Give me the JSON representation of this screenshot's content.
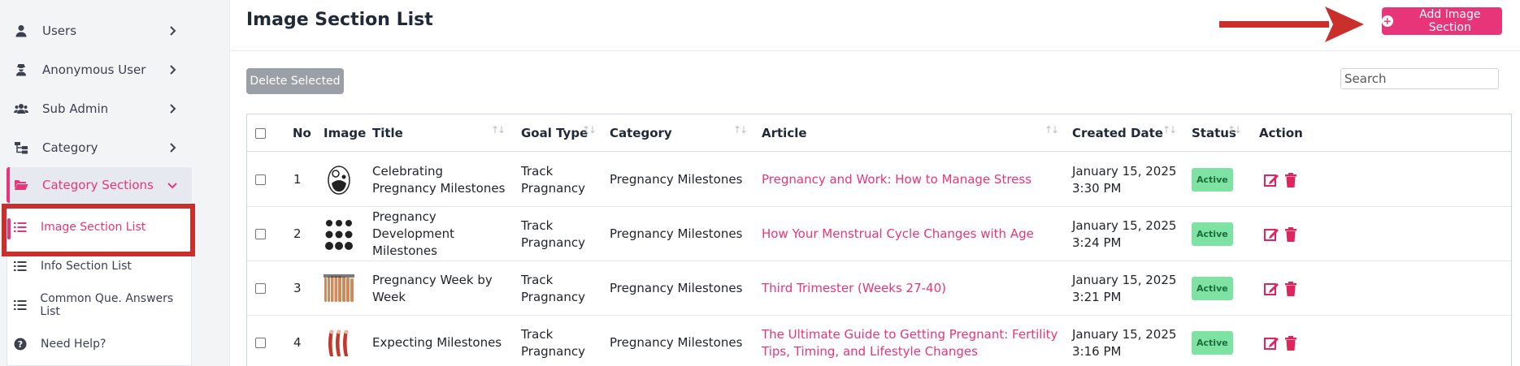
{
  "sidebar": {
    "items": [
      {
        "label": "Users",
        "icon": "user-icon"
      },
      {
        "label": "Anonymous User",
        "icon": "user-secret-icon"
      },
      {
        "label": "Sub Admin",
        "icon": "users-icon"
      },
      {
        "label": "Category",
        "icon": "sitemap-icon"
      },
      {
        "label": "Category Sections",
        "icon": "folder-open-icon"
      }
    ],
    "sub_items": [
      {
        "label": "Image Section List",
        "icon": "list-icon"
      },
      {
        "label": "Info Section List",
        "icon": "list-icon"
      },
      {
        "label": "Common Que. Answers List",
        "icon": "list-icon"
      },
      {
        "label": "Need Help?",
        "icon": "question-circle-icon"
      }
    ]
  },
  "header": {
    "title": "Image Section List",
    "add_button": "Add Image Section"
  },
  "toolbar": {
    "delete_selected": "Delete Selected",
    "search_placeholder": "Search"
  },
  "table": {
    "columns": [
      "No",
      "Image",
      "Title",
      "Goal Type",
      "Category",
      "Article",
      "Created Date",
      "Status",
      "Action"
    ],
    "rows": [
      {
        "no": "1",
        "title": "Celebrating Pregnancy Milestones",
        "goal_type": "Track Pragnancy",
        "category": "Pregnancy Milestones",
        "article": "Pregnancy and Work: How to Manage Stress",
        "created": "January 15, 2025 3:30 PM",
        "status": "Active"
      },
      {
        "no": "2",
        "title": "Pregnancy Development Milestones",
        "goal_type": "Track Pragnancy",
        "category": "Pregnancy Milestones",
        "article": "How Your Menstrual Cycle Changes with Age",
        "created": "January 15, 2025 3:24 PM",
        "status": "Active"
      },
      {
        "no": "3",
        "title": "Pregnancy Week by Week",
        "goal_type": "Track Pragnancy",
        "category": "Pregnancy Milestones",
        "article": "Third Trimester (Weeks 27-40)",
        "created": "January 15, 2025 3:21 PM",
        "status": "Active"
      },
      {
        "no": "4",
        "title": "Expecting Milestones",
        "goal_type": "Track Pragnancy",
        "category": "Pregnancy Milestones",
        "article": "The Ultimate Guide to Getting Pregnant: Fertility Tips, Timing, and Lifestyle Changes",
        "created": "January 15, 2025 3:16 PM",
        "status": "Active"
      }
    ]
  },
  "colors": {
    "accent": "#e8357a",
    "status_active_bg": "#7ee3a2",
    "annotation_red": "#c9302c"
  }
}
